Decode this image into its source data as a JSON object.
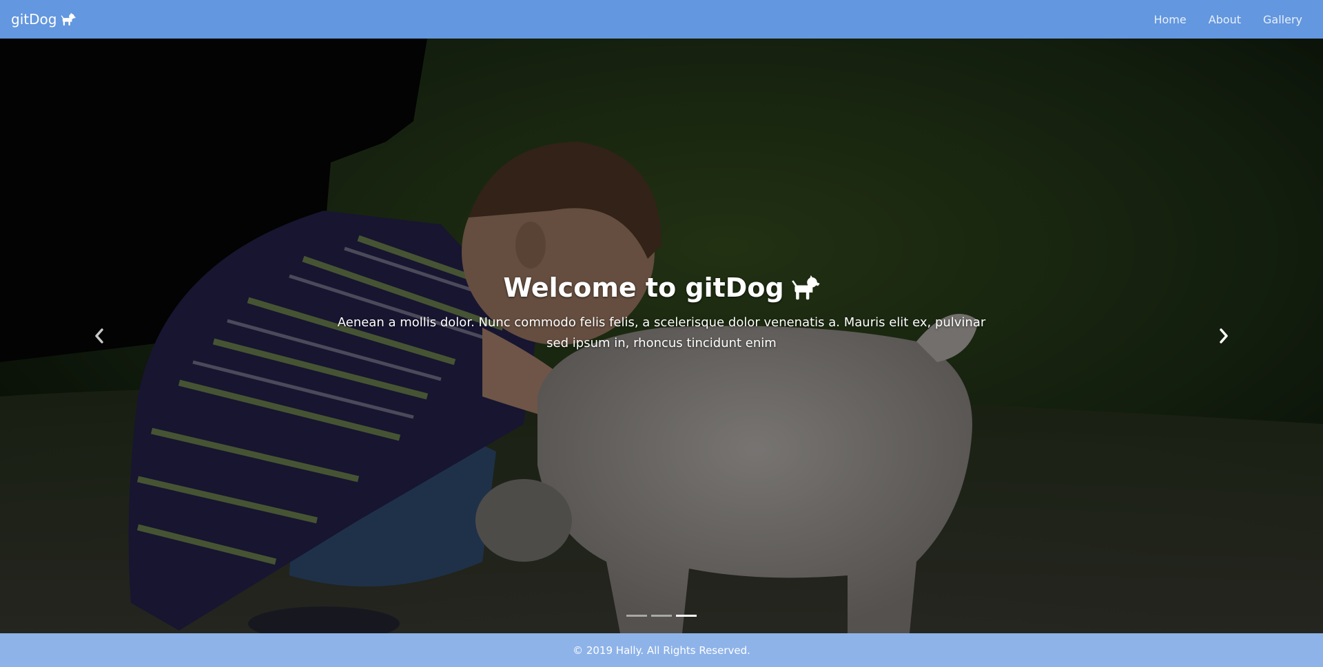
{
  "navbar": {
    "brand": "gitDog",
    "brand_icon": "dog-icon",
    "links": [
      {
        "label": "Home"
      },
      {
        "label": "About"
      },
      {
        "label": "Gallery"
      }
    ],
    "background": "#6397df"
  },
  "hero": {
    "title": "Welcome to gitDog",
    "title_icon": "dog-icon",
    "text": "Aenean a mollis dolor. Nunc commodo felis felis, a scelerisque dolor venenatis a. Mauris elit ex, pulvinar sed ipsum in, rhoncus tincidunt enim",
    "prev_icon": "chevron-left-icon",
    "next_icon": "chevron-right-icon",
    "slide_count": 3,
    "active_slide": 3
  },
  "footer": {
    "text": "© 2019 Hally. All Rights Reserved.",
    "background": "#8eb3e9"
  }
}
